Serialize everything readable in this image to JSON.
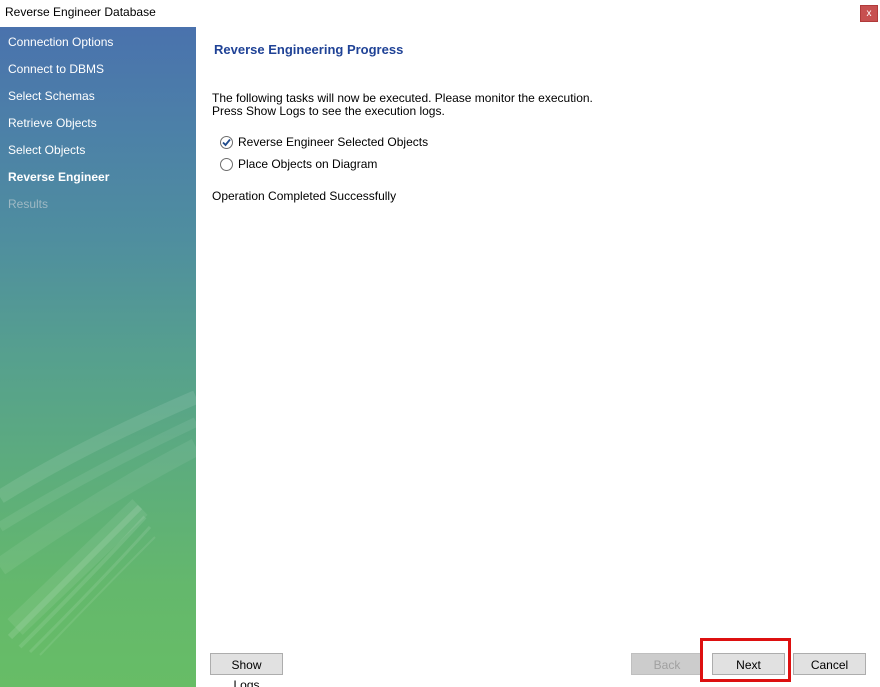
{
  "window": {
    "title": "Reverse Engineer Database",
    "close_label": "x"
  },
  "sidebar": {
    "items": [
      {
        "label": "Connection Options",
        "state": "done"
      },
      {
        "label": "Connect to DBMS",
        "state": "done"
      },
      {
        "label": "Select Schemas",
        "state": "done"
      },
      {
        "label": "Retrieve Objects",
        "state": "done"
      },
      {
        "label": "Select Objects",
        "state": "done"
      },
      {
        "label": "Reverse Engineer",
        "state": "active"
      },
      {
        "label": "Results",
        "state": "disabled"
      }
    ]
  },
  "main": {
    "title": "Reverse Engineering Progress",
    "description_line1": "The following tasks will now be executed. Please monitor the execution.",
    "description_line2": "Press Show Logs to see the execution logs.",
    "tasks": [
      {
        "label": "Reverse Engineer Selected Objects",
        "done": true
      },
      {
        "label": "Place Objects on Diagram",
        "done": false
      }
    ],
    "status": "Operation Completed Successfully"
  },
  "buttons": {
    "show_logs": "Show Logs",
    "back": "Back",
    "next": "Next",
    "cancel": "Cancel"
  },
  "colors": {
    "title_blue": "#1f4296",
    "highlight_red": "#dd1010",
    "check_blue": "#1f4a8c"
  }
}
